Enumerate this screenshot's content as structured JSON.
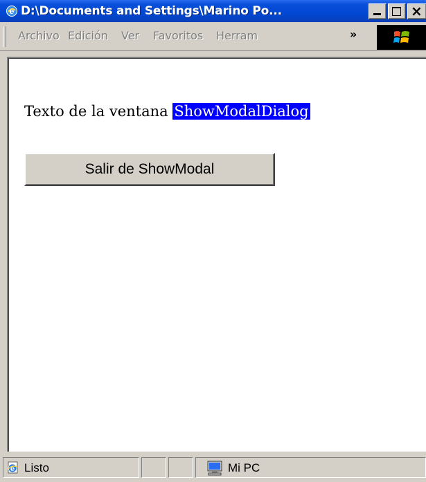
{
  "window": {
    "title": "D:\\Documents and Settings\\Marino Po...",
    "icon": "ie-icon",
    "controls": {
      "minimize": "minimize-icon",
      "maximize": "maximize-icon",
      "close": "×"
    }
  },
  "menubar": {
    "items": [
      "Archivo",
      "Edición",
      "Ver",
      "Favoritos",
      "Herram"
    ],
    "overflow": "»",
    "logo": "windows-logo-icon"
  },
  "page": {
    "text": "Texto de la ventana",
    "highlighted_text": "ShowModalDialog",
    "highlight_color": "#0000ff",
    "exit_button": "Salir de ShowModal"
  },
  "statusbar": {
    "status": "Listo",
    "zone": "Mi PC"
  },
  "colors": {
    "titlebar": "#0047d4",
    "chrome": "#d4d0c8",
    "content_bg": "#ffffff"
  }
}
